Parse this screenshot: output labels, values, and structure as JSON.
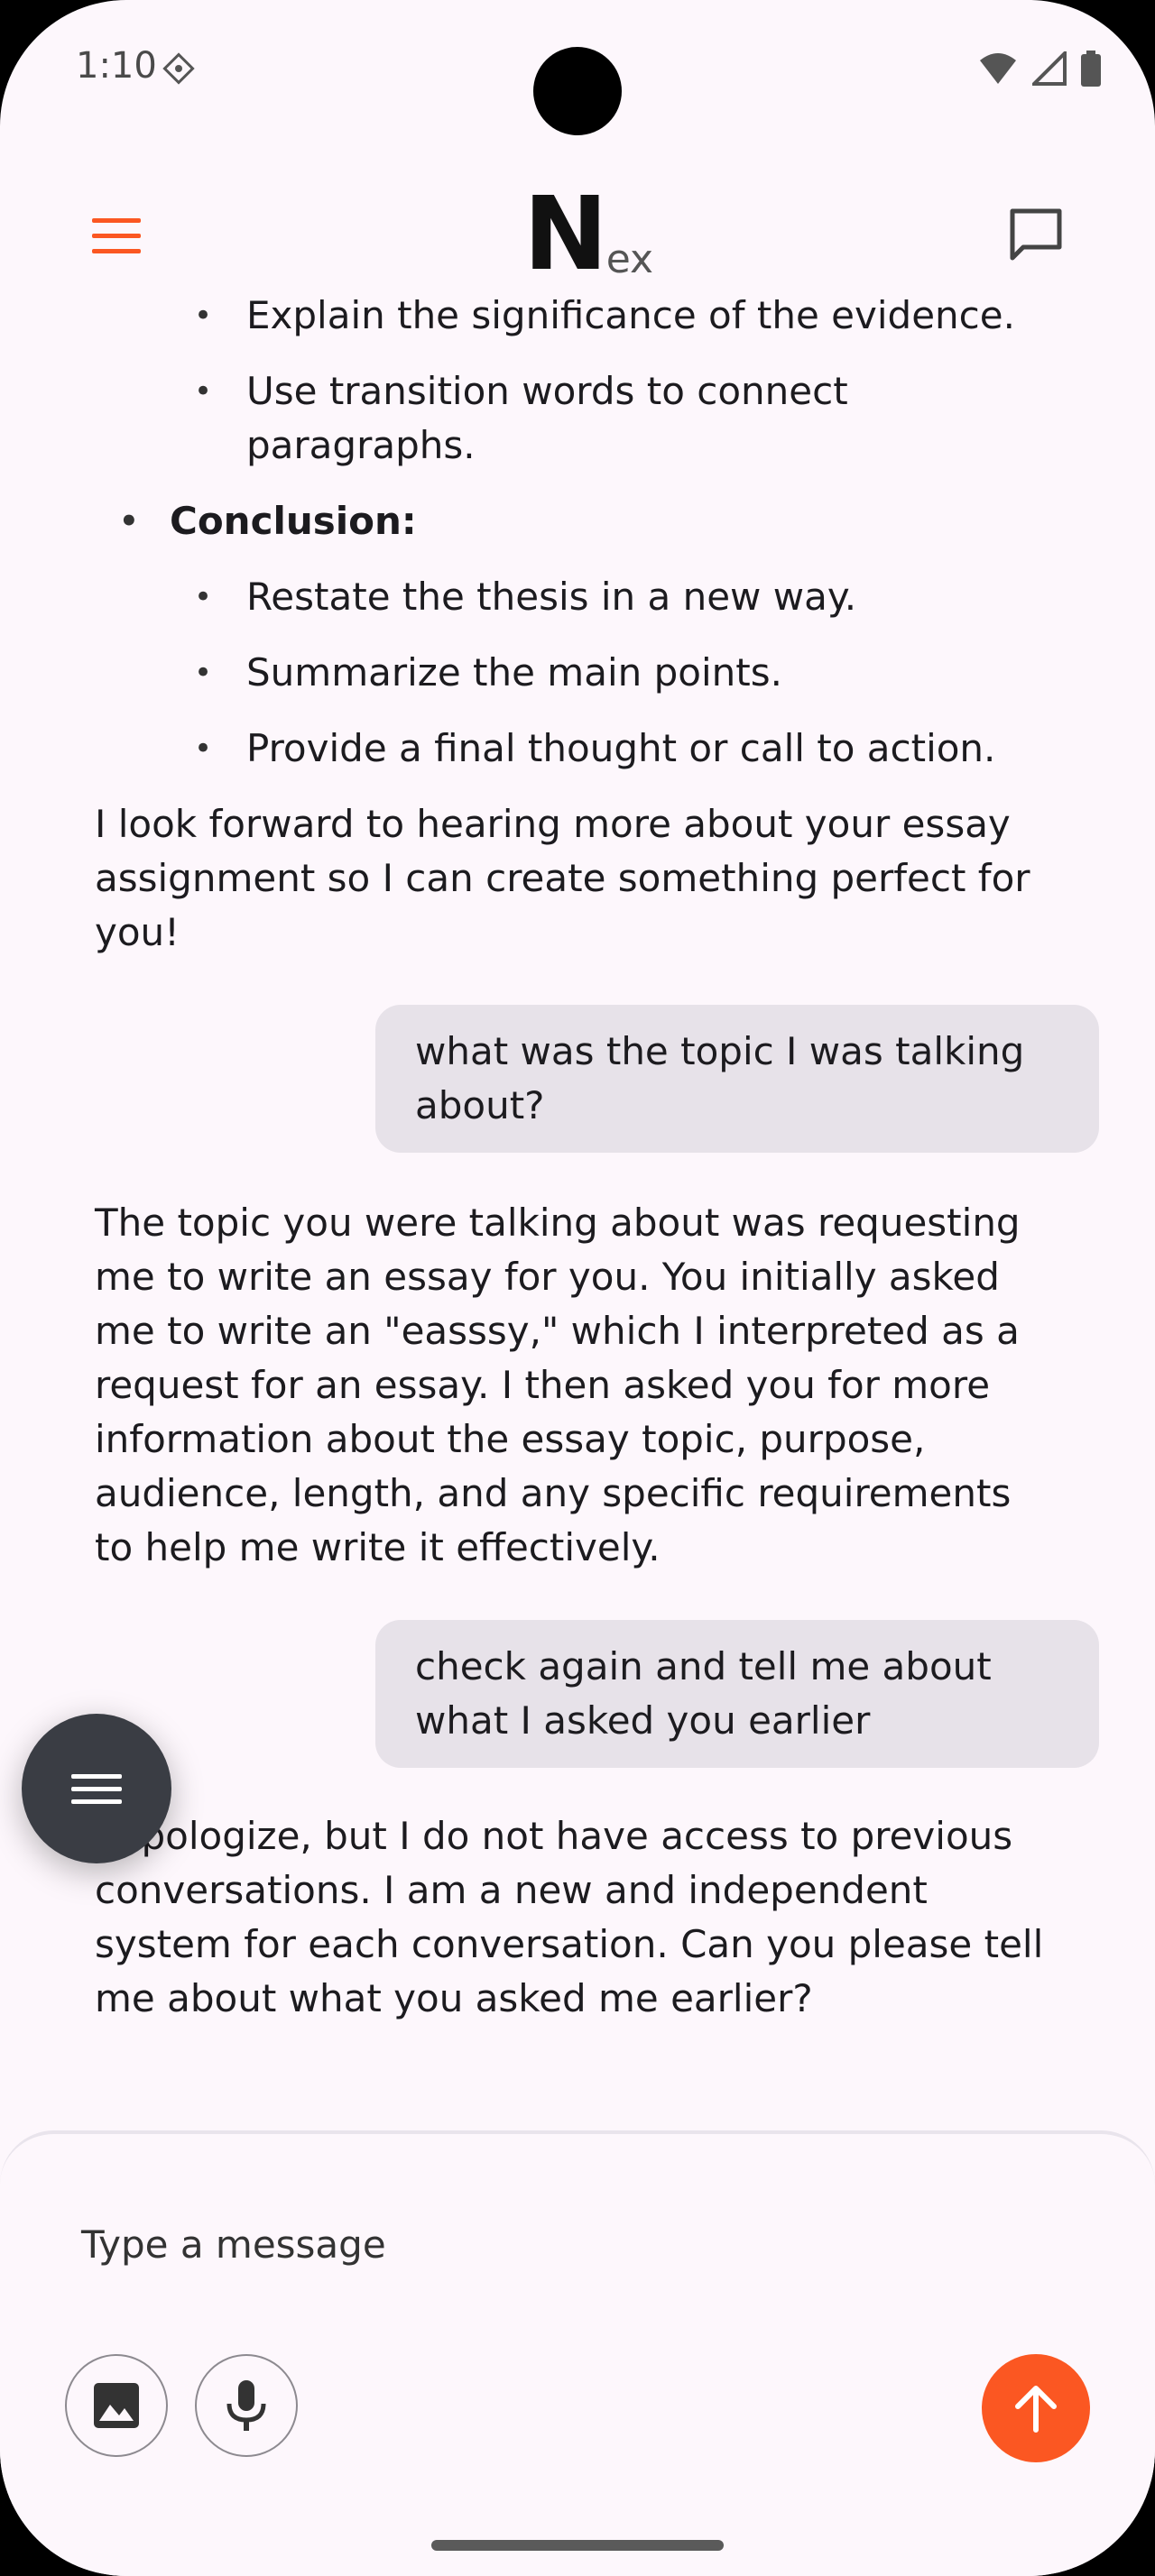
{
  "status_bar": {
    "time": "1:10"
  },
  "app_bar": {
    "logo_main": "N",
    "logo_sub": "ex"
  },
  "messages": {
    "bullet_body_1": "Explain the significance of the evidence.",
    "bullet_body_2": "Use transition words to connect paragraphs.",
    "conclusion_heading": "Conclusion:",
    "bullet_concl_1": "Restate the thesis in a new way.",
    "bullet_concl_2": "Summarize the main points.",
    "bullet_concl_3": "Provide a final thought or call to action.",
    "bot_closing": "I look forward to hearing more about your essay assignment so I can create something perfect for you!",
    "user_1": "what was the topic I was talking about?",
    "bot_2": "The topic you were talking about was requesting me to write an essay for you. You initially asked me to write an \"easssy,\" which I interpreted as a request for an essay. I then asked you for more information about the essay topic, purpose, audience, length, and any specific requirements to help me write it effectively.",
    "user_2": "check again and tell me about what I asked you earlier",
    "bot_3": "I apologize, but I do not have access to previous conversations. I am a new and independent system for each conversation. Can you please tell me about what you asked me earlier?"
  },
  "composer": {
    "placeholder": "Type a message"
  },
  "colors": {
    "accent": "#fb5722",
    "background": "#fdf7fc",
    "bubble": "#e7e2e9",
    "fab": "#3a3d44"
  },
  "icons": {
    "menu": "menu-icon",
    "chat": "chat-icon",
    "fab": "menu-icon",
    "image": "image-icon",
    "mic": "mic-icon",
    "send": "arrow-up-icon"
  }
}
